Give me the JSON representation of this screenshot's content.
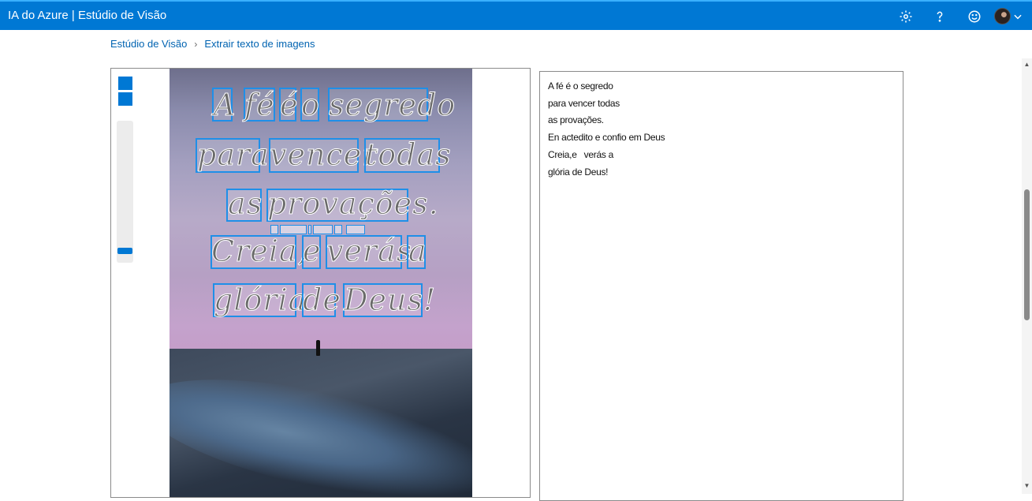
{
  "app": {
    "title": "IA do Azure | Estúdio de Visão"
  },
  "header_icons": [
    "gear-icon",
    "help-icon",
    "feedback-smiley-icon",
    "avatar",
    "chevron-down-icon"
  ],
  "breadcrumb": {
    "home": "Estúdio de Visão",
    "separator": "›",
    "current": "Extrair texto de imagens"
  },
  "colors": {
    "accent": "#0078d4",
    "box": "#1f8fe8"
  },
  "image": {
    "lines": [
      {
        "words": [
          "A",
          "fé",
          "é",
          "o",
          "segredo"
        ]
      },
      {
        "words": [
          "para",
          "vencer",
          "todas"
        ]
      },
      {
        "words": [
          "as",
          "provações."
        ]
      },
      {
        "words": [
          "Creia,",
          "e",
          "verás",
          "a"
        ]
      },
      {
        "words": [
          "glória",
          "de",
          "Deus!"
        ]
      }
    ]
  },
  "result": {
    "lines": [
      "A fé é o segredo",
      "para vencer todas",
      "as provações.",
      "En actedito e confio em Deus",
      "Creia,e   verás a",
      "glória de Deus!"
    ]
  }
}
